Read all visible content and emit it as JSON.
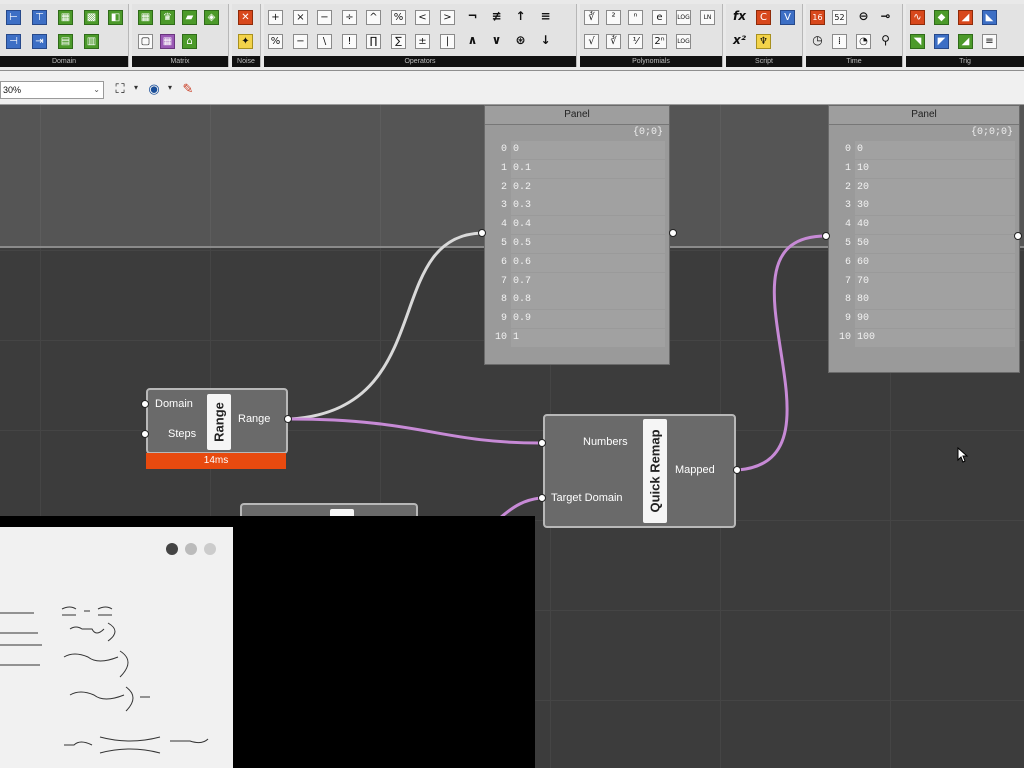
{
  "ribbon": {
    "groups": [
      {
        "label": "Domain",
        "name": "domain"
      },
      {
        "label": "Matrix",
        "name": "matrix"
      },
      {
        "label": "Noise",
        "name": "noise"
      },
      {
        "label": "Operators",
        "name": "operators"
      },
      {
        "label": "Polynomials",
        "name": "polynomials"
      },
      {
        "label": "Script",
        "name": "script"
      },
      {
        "label": "Time",
        "name": "time"
      },
      {
        "label": "Trig",
        "name": "trig"
      }
    ],
    "icon_text": {
      "ln": "LN",
      "log": "LOG",
      "log2": "LOG",
      "num16": "16",
      "num52": "52",
      "fx": "fx",
      "x2": "x²"
    }
  },
  "toolbar": {
    "zoom_value": "30%",
    "zoom_arrow": "⌄",
    "small_arrow": "▾"
  },
  "panels": [
    {
      "title": "Panel",
      "path": "{0;0}",
      "rows": [
        {
          "i": "0",
          "v": "0"
        },
        {
          "i": "1",
          "v": "0.1"
        },
        {
          "i": "2",
          "v": "0.2"
        },
        {
          "i": "3",
          "v": "0.3"
        },
        {
          "i": "4",
          "v": "0.4"
        },
        {
          "i": "5",
          "v": "0.5"
        },
        {
          "i": "6",
          "v": "0.6"
        },
        {
          "i": "7",
          "v": "0.7"
        },
        {
          "i": "8",
          "v": "0.8"
        },
        {
          "i": "9",
          "v": "0.9"
        },
        {
          "i": "10",
          "v": "1"
        }
      ]
    },
    {
      "title": "Panel",
      "path": "{0;0;0}",
      "rows": [
        {
          "i": "0",
          "v": "0"
        },
        {
          "i": "1",
          "v": "10"
        },
        {
          "i": "2",
          "v": "20"
        },
        {
          "i": "3",
          "v": "30"
        },
        {
          "i": "4",
          "v": "40"
        },
        {
          "i": "5",
          "v": "50"
        },
        {
          "i": "6",
          "v": "60"
        },
        {
          "i": "7",
          "v": "70"
        },
        {
          "i": "8",
          "v": "80"
        },
        {
          "i": "9",
          "v": "90"
        },
        {
          "i": "10",
          "v": "100"
        }
      ]
    }
  ],
  "range_component": {
    "nickname": "Range",
    "inputs": [
      "Domain",
      "Steps"
    ],
    "output": "Range",
    "profiler": "14ms"
  },
  "remap_component": {
    "nickname": "Quick Remap",
    "inputs": [
      "Numbers",
      "Target Domain"
    ],
    "output": "Mapped"
  },
  "colors": {
    "canvas": "#3c3c3c",
    "component": "#6a6a6a",
    "panel": "#9a9a9a",
    "profiler": "#e84a0f",
    "wire": "#d9d9d9",
    "wire_selected": "#c78ad6"
  }
}
